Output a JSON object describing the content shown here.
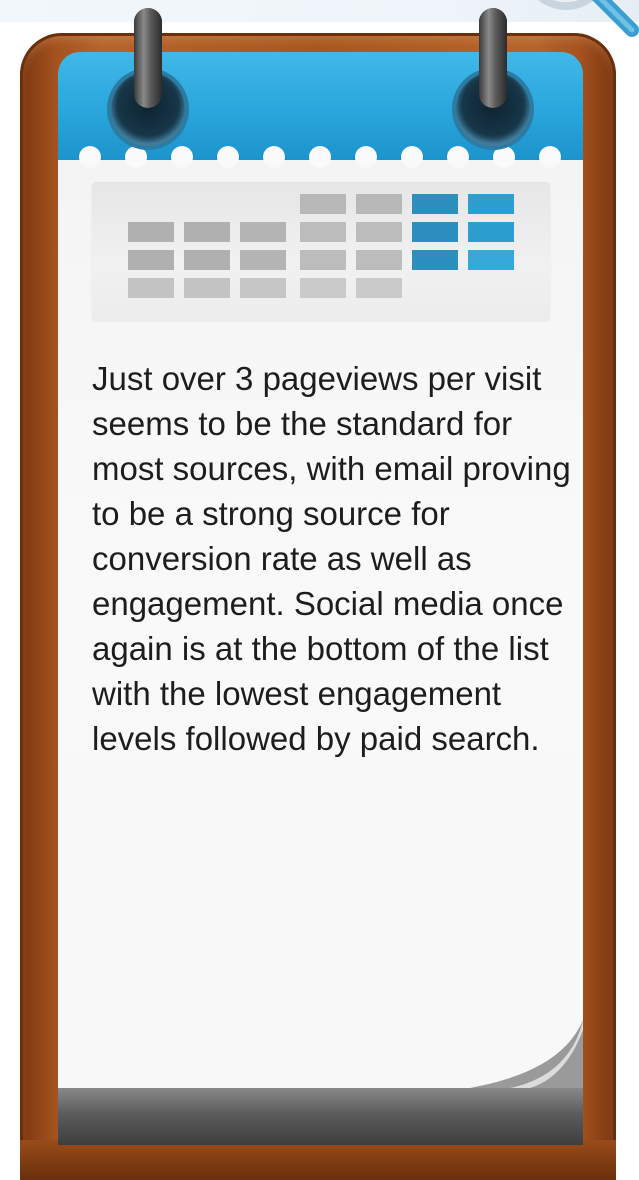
{
  "card": {
    "message": "Just over 3 pageviews per visit seems to be the standard for most sources, with email proving to be a strong source for conversion rate as well as engagement. Social media once again is at the bottom of the list with the lowest engagement levels followed by paid search."
  },
  "colors": {
    "header_blue": "#2aa6dc",
    "board_brown": "#a8571f",
    "paper": "#f8f8f8",
    "cell_gray": "#b5b5b5",
    "cell_blue": "#2c9fd0"
  },
  "icons": {
    "top_right": "magnifier-icon",
    "rings": "binder-ring-icon"
  }
}
